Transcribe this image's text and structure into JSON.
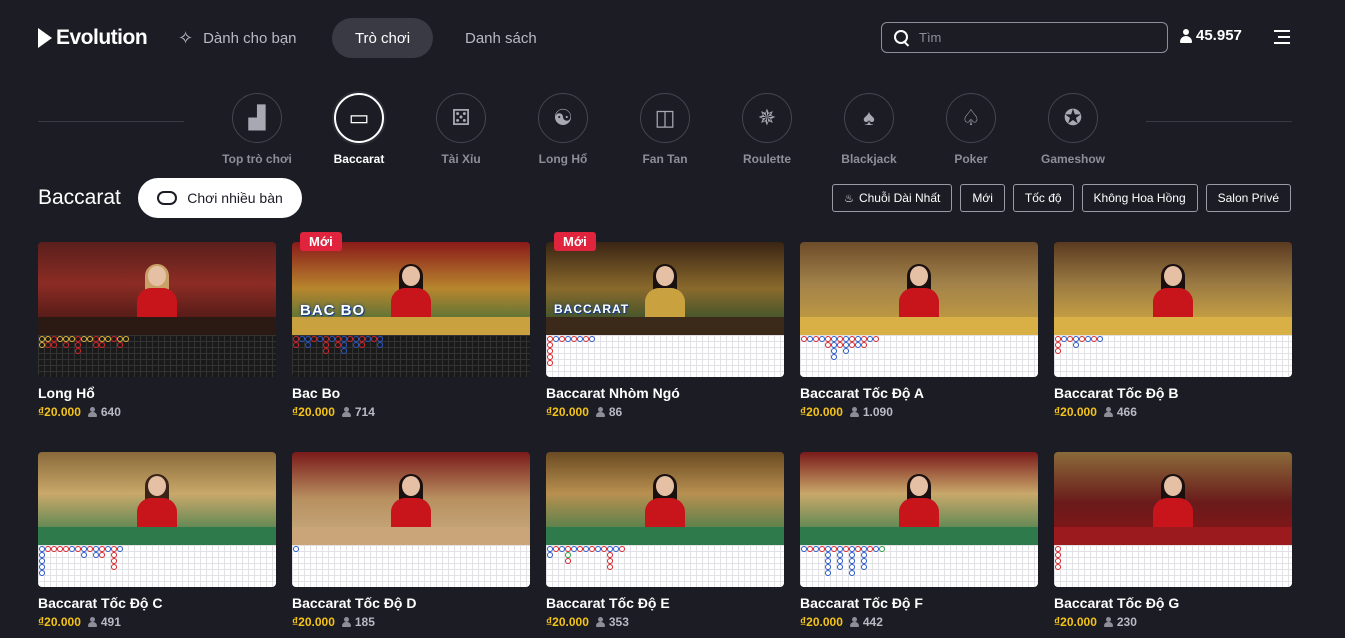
{
  "brand": {
    "name": "Evolution"
  },
  "nav": {
    "for_you": "Dành cho bạn",
    "games": "Trò chơi",
    "list": "Danh sách"
  },
  "search": {
    "placeholder": "Tìm"
  },
  "players_online": "45.957",
  "categories": [
    {
      "label": "Top trò chơi",
      "icon": "podium-icon"
    },
    {
      "label": "Baccarat",
      "icon": "baccarat-icon"
    },
    {
      "label": "Tài Xỉu",
      "icon": "dice-icon"
    },
    {
      "label": "Long Hổ",
      "icon": "dragon-tiger-icon"
    },
    {
      "label": "Fan Tan",
      "icon": "fan-tan-icon"
    },
    {
      "label": "Roulette",
      "icon": "roulette-icon"
    },
    {
      "label": "Blackjack",
      "icon": "blackjack-icon"
    },
    {
      "label": "Poker",
      "icon": "poker-icon"
    },
    {
      "label": "Gameshow",
      "icon": "gameshow-icon"
    }
  ],
  "active_category": "Baccarat",
  "section": {
    "title": "Baccarat",
    "multi_table": "Chơi nhiều bàn"
  },
  "filters": [
    "Chuỗi Dài Nhất",
    "Mới",
    "Tốc độ",
    "Không Hoa Hồng",
    "Salon Privé"
  ],
  "badge_new": "Mới",
  "logos": {
    "bac_bo": "BAC BO",
    "peek_baccarat": "BACCARAT"
  },
  "games": [
    {
      "title": "Long Hổ",
      "price": "₫20.000",
      "players": "640",
      "new": false
    },
    {
      "title": "Bac Bo",
      "price": "₫20.000",
      "players": "714",
      "new": true
    },
    {
      "title": "Baccarat Nhòm Ngó",
      "price": "₫20.000",
      "players": "86",
      "new": true
    },
    {
      "title": "Baccarat Tốc Độ A",
      "price": "₫20.000",
      "players": "1.090",
      "new": false
    },
    {
      "title": "Baccarat Tốc Độ B",
      "price": "₫20.000",
      "players": "466",
      "new": false
    },
    {
      "title": "Baccarat Tốc Độ C",
      "price": "₫20.000",
      "players": "491",
      "new": false
    },
    {
      "title": "Baccarat Tốc Độ D",
      "price": "₫20.000",
      "players": "185",
      "new": false
    },
    {
      "title": "Baccarat Tốc Độ E",
      "price": "₫20.000",
      "players": "353",
      "new": false
    },
    {
      "title": "Baccarat Tốc Độ F",
      "price": "₫20.000",
      "players": "442",
      "new": false
    },
    {
      "title": "Baccarat Tốc Độ G",
      "price": "₫20.000",
      "players": "230",
      "new": false
    }
  ],
  "colors": {
    "accent_price": "#f3c319",
    "badge": "#e0243d",
    "background": "#1c1c25"
  }
}
